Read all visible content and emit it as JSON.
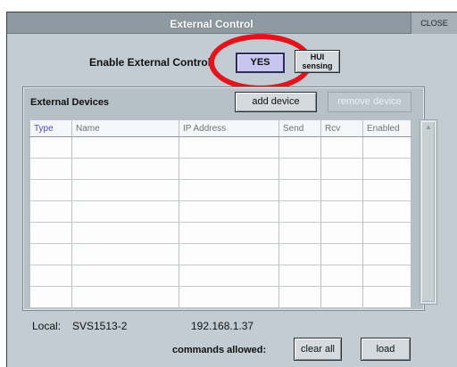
{
  "window": {
    "title": "External Control",
    "close_label": "CLOSE"
  },
  "enable": {
    "label": "Enable External Control:",
    "yes_label": "YES",
    "hui_line1": "HUI",
    "hui_line2": "sensing"
  },
  "devices": {
    "title": "External Devices",
    "add_label": "add device",
    "remove_label": "remove device",
    "columns": [
      "Type",
      "Name",
      "IP Address",
      "Send",
      "Rcv",
      "Enabled"
    ],
    "row_count": 8
  },
  "footer": {
    "local_label": "Local:",
    "local_name": "SVS1513-2",
    "local_ip": "192.168.1.37",
    "commands_label": "commands allowed:",
    "clear_label": "clear all",
    "load_label": "load"
  },
  "colors": {
    "title_bar": "#8e9aa1",
    "window_bg": "#c2ccd2",
    "yes_active": "#c8c6f0",
    "annotation_ring": "#e3141b"
  },
  "icons": {
    "scroll_up": "chevron-up-icon"
  }
}
